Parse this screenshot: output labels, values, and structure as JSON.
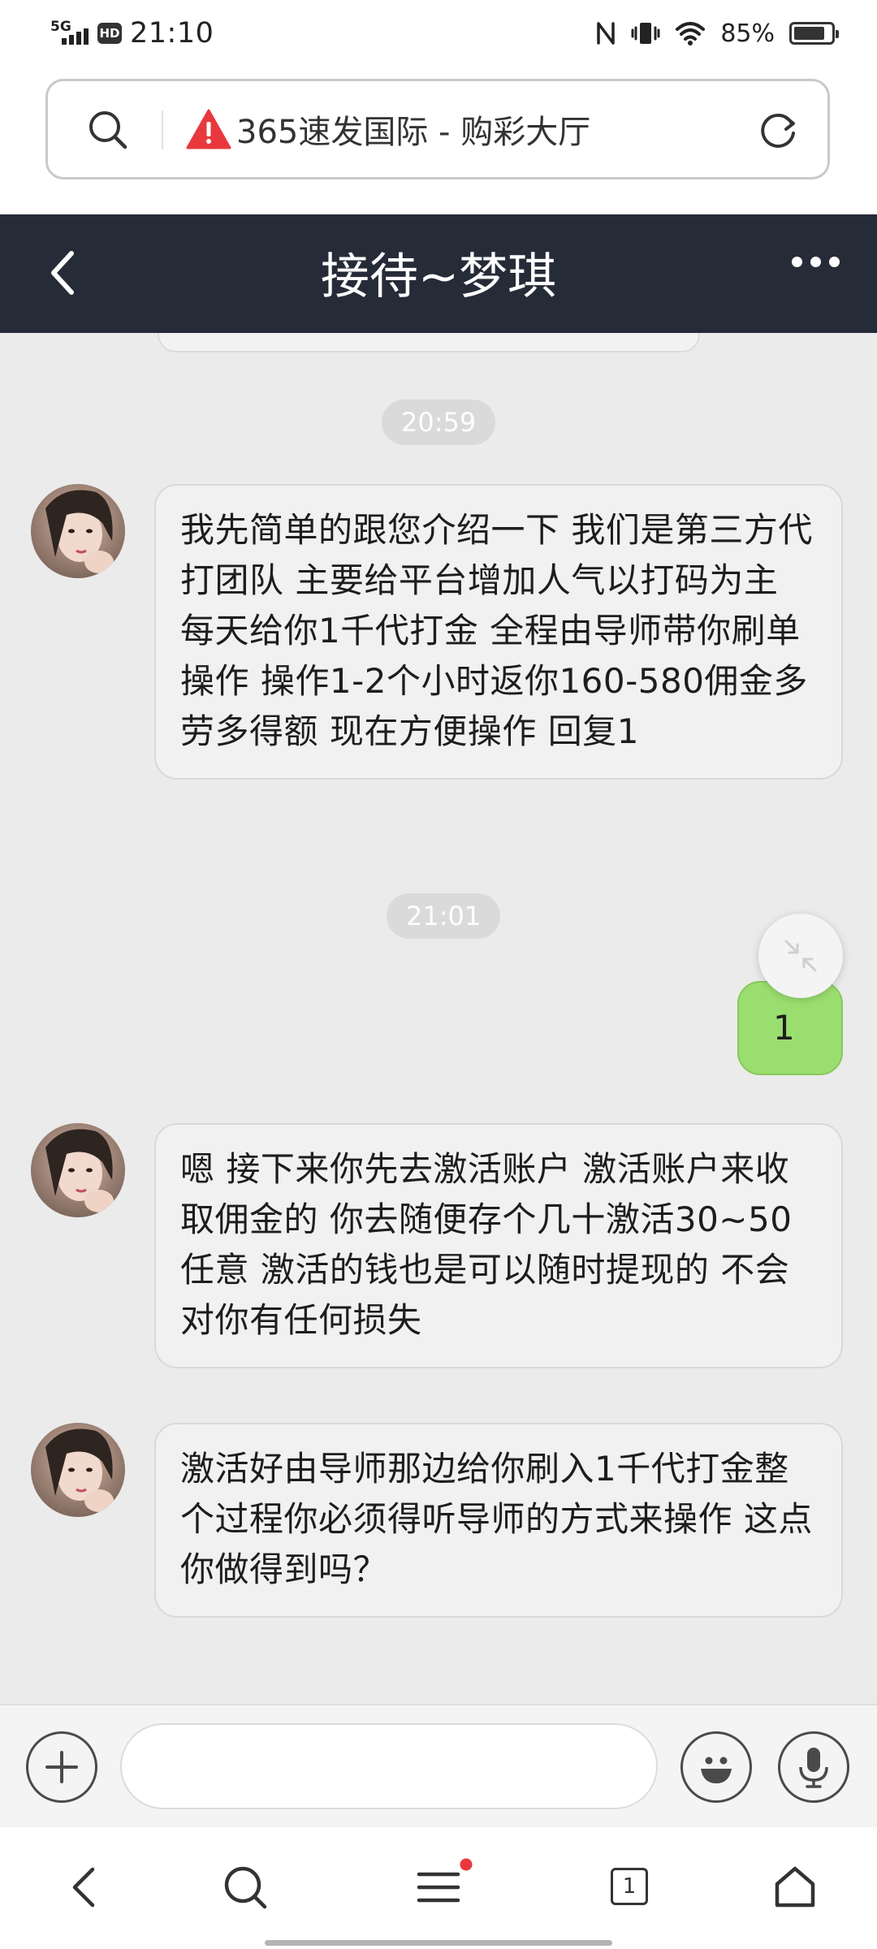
{
  "status_bar": {
    "network": "5G",
    "hd": "HD",
    "time": "21:10",
    "battery_percent": "85%",
    "battery_level": 0.85,
    "icons": [
      "nfc-icon",
      "vibrate-icon",
      "wifi-icon",
      "battery-icon"
    ]
  },
  "browser": {
    "url_title": "365速发国际 - 购彩大厅",
    "warning_color": "#e8383d",
    "tab_count": "1"
  },
  "chat": {
    "title": "接待~梦琪",
    "header_color": "#262b38",
    "my_bubble_color": "#9bde70",
    "messages": [
      {
        "type": "time",
        "text": "20:59"
      },
      {
        "type": "received",
        "text": "我先简单的跟您介绍一下 我们是第三方代打团队 主要给平台增加人气以打码为主 每天给你1千代打金 全程由导师带你刷单操作 操作1-2个小时返你160-580佣金多劳多得额 现在方便操作 回复1"
      },
      {
        "type": "time",
        "text": "21:01"
      },
      {
        "type": "sent",
        "text": "1"
      },
      {
        "type": "received",
        "text": "嗯 接下来你先去激活账户 激活账户来收取佣金的 你去随便存个几十激活30~50任意 激活的钱也是可以随时提现的 不会对你有任何损失"
      },
      {
        "type": "received",
        "text": "激活好由导师那边给你刷入1千代打金整个过程你必须得听导师的方式来操作 这点你做得到吗？"
      }
    ]
  },
  "input_bar": {
    "placeholder": ""
  }
}
